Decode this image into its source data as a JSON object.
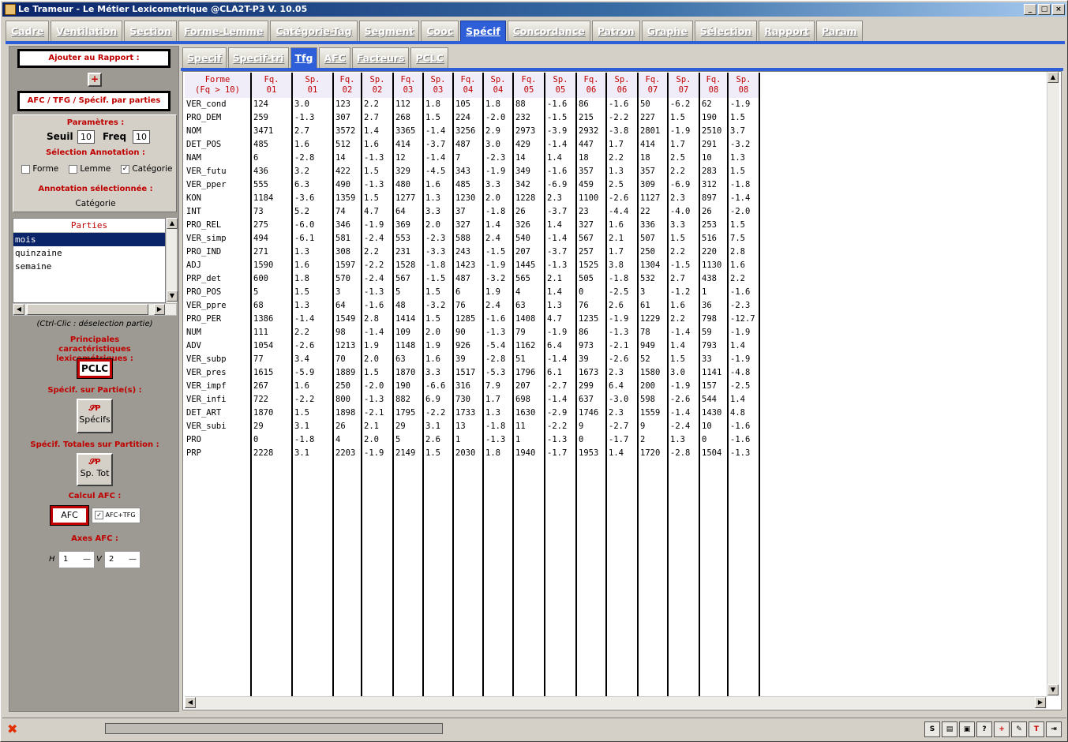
{
  "window": {
    "title": "Le Trameur - Le Métier Lexicometrique @CLA2T-P3 V. 10.05",
    "min": "_",
    "max": "□",
    "close": "×"
  },
  "main_tabs": [
    "Cadre",
    "Ventilation",
    "Section",
    "Forme-Lemme",
    "Catégorie-Tag",
    "Segment",
    "Cooc",
    "Spécif",
    "Concordance",
    "Patron",
    "Graphe",
    "Sélection",
    "Rapport",
    "Param"
  ],
  "active_main_tab": "Spécif",
  "sub_tabs": [
    "Specif",
    "Specif-tri",
    "Tfg",
    "AFC",
    "Facteurs",
    "PCLC"
  ],
  "active_sub_tab": "Tfg",
  "left": {
    "ajouter_rapport": "Ajouter au Rapport :",
    "plus_icon": "+",
    "afc_tfg": "AFC / TFG / Spécif. par parties",
    "parametres": "Paramètres :",
    "seuil_label": "Seuil",
    "seuil_value": "10",
    "freq_label": "Freq",
    "freq_value": "10",
    "selection_annotation": "Sélection Annotation :",
    "opt_forme": "Forme",
    "opt_lemme": "Lemme",
    "opt_categorie": "Catégorie",
    "annotation_selectionnee": "Annotation sélectionnée :",
    "annotation_value": "Catégorie",
    "parties_header": "Parties",
    "parties": [
      "mois",
      "quinzaine",
      "semaine"
    ],
    "ctrl_hint": "(Ctrl-Clic : déselection partie)",
    "principales": "Principales caractéristiques lexicométriques :",
    "pclc_btn": "PCLC",
    "specif_parties": "Spécif. sur Partie(s) :",
    "specifs_btn": "Spécifs",
    "specif_totales": "Spécif. Totales sur Partition :",
    "sptot_btn": "Sp. Tot",
    "calcul_afc": "Calcul AFC :",
    "afc_btn": "AFC",
    "afc_tfg_chk": "AFC+TFG",
    "axes_afc": "Axes AFC :",
    "h_label": "H",
    "h_value": "1",
    "v_label": "V",
    "v_value": "2"
  },
  "table": {
    "headers": [
      [
        "Forme",
        "(Fq > 10)"
      ],
      [
        "Fq.",
        "01"
      ],
      [
        "Sp.",
        "01"
      ],
      [
        "Fq.",
        "02"
      ],
      [
        "Sp.",
        "02"
      ],
      [
        "Fq.",
        "03"
      ],
      [
        "Sp.",
        "03"
      ],
      [
        "Fq.",
        "04"
      ],
      [
        "Sp.",
        "04"
      ],
      [
        "Fq.",
        "05"
      ],
      [
        "Sp.",
        "05"
      ],
      [
        "Fq.",
        "06"
      ],
      [
        "Sp.",
        "06"
      ],
      [
        "Fq.",
        "07"
      ],
      [
        "Sp.",
        "07"
      ],
      [
        "Fq.",
        "08"
      ],
      [
        "Sp.",
        "08"
      ]
    ],
    "rows": [
      [
        "VER_cond",
        "124",
        "3.0",
        "123",
        "2.2",
        "112",
        "1.8",
        "105",
        "1.8",
        "88",
        "-1.6",
        "86",
        "-1.6",
        "50",
        "-6.2",
        "62",
        "-1.9"
      ],
      [
        "PRO_DEM",
        "259",
        "-1.3",
        "307",
        "2.7",
        "268",
        "1.5",
        "224",
        "-2.0",
        "232",
        "-1.5",
        "215",
        "-2.2",
        "227",
        "1.5",
        "190",
        "1.5"
      ],
      [
        "NOM",
        "3471",
        "2.7",
        "3572",
        "1.4",
        "3365",
        "-1.4",
        "3256",
        "2.9",
        "2973",
        "-3.9",
        "2932",
        "-3.8",
        "2801",
        "-1.9",
        "2510",
        "3.7"
      ],
      [
        "DET_POS",
        "485",
        "1.6",
        "512",
        "1.6",
        "414",
        "-3.7",
        "487",
        "3.0",
        "429",
        "-1.4",
        "447",
        "1.7",
        "414",
        "1.7",
        "291",
        "-3.2"
      ],
      [
        "NAM",
        "6",
        "-2.8",
        "14",
        "-1.3",
        "12",
        "-1.4",
        "7",
        "-2.3",
        "14",
        "1.4",
        "18",
        "2.2",
        "18",
        "2.5",
        "10",
        "1.3"
      ],
      [
        "VER_futu",
        "436",
        "3.2",
        "422",
        "1.5",
        "329",
        "-4.5",
        "343",
        "-1.9",
        "349",
        "-1.6",
        "357",
        "1.3",
        "357",
        "2.2",
        "283",
        "1.5"
      ],
      [
        "VER_pper",
        "555",
        "6.3",
        "490",
        "-1.3",
        "480",
        "1.6",
        "485",
        "3.3",
        "342",
        "-6.9",
        "459",
        "2.5",
        "309",
        "-6.9",
        "312",
        "-1.8"
      ],
      [
        "KON",
        "1184",
        "-3.6",
        "1359",
        "1.5",
        "1277",
        "1.3",
        "1230",
        "2.0",
        "1228",
        "2.3",
        "1100",
        "-2.6",
        "1127",
        "2.3",
        "897",
        "-1.4"
      ],
      [
        "INT",
        "73",
        "5.2",
        "74",
        "4.7",
        "64",
        "3.3",
        "37",
        "-1.8",
        "26",
        "-3.7",
        "23",
        "-4.4",
        "22",
        "-4.0",
        "26",
        "-2.0"
      ],
      [
        "PRO_REL",
        "275",
        "-6.0",
        "346",
        "-1.9",
        "369",
        "2.0",
        "327",
        "1.4",
        "326",
        "1.4",
        "327",
        "1.6",
        "336",
        "3.3",
        "253",
        "1.5"
      ],
      [
        "VER_simp",
        "494",
        "-6.1",
        "581",
        "-2.4",
        "553",
        "-2.3",
        "588",
        "2.4",
        "540",
        "-1.4",
        "567",
        "2.1",
        "507",
        "1.5",
        "516",
        "7.5"
      ],
      [
        "PRO_IND",
        "271",
        "1.3",
        "308",
        "2.2",
        "231",
        "-3.3",
        "243",
        "-1.5",
        "207",
        "-3.7",
        "257",
        "1.7",
        "250",
        "2.2",
        "220",
        "2.8"
      ],
      [
        "ADJ",
        "1590",
        "1.6",
        "1597",
        "-2.2",
        "1528",
        "-1.8",
        "1423",
        "-1.9",
        "1445",
        "-1.3",
        "1525",
        "3.8",
        "1304",
        "-1.5",
        "1130",
        "1.6"
      ],
      [
        "PRP_det",
        "600",
        "1.8",
        "570",
        "-2.4",
        "567",
        "-1.5",
        "487",
        "-3.2",
        "565",
        "2.1",
        "505",
        "-1.8",
        "532",
        "2.7",
        "438",
        "2.2"
      ],
      [
        "PRO_POS",
        "5",
        "1.5",
        "3",
        "-1.3",
        "5",
        "1.5",
        "6",
        "1.9",
        "4",
        "1.4",
        "0",
        "-2.5",
        "3",
        "-1.2",
        "1",
        "-1.6"
      ],
      [
        "VER_ppre",
        "68",
        "1.3",
        "64",
        "-1.6",
        "48",
        "-3.2",
        "76",
        "2.4",
        "63",
        "1.3",
        "76",
        "2.6",
        "61",
        "1.6",
        "36",
        "-2.3"
      ],
      [
        "PRO_PER",
        "1386",
        "-1.4",
        "1549",
        "2.8",
        "1414",
        "1.5",
        "1285",
        "-1.6",
        "1408",
        "4.7",
        "1235",
        "-1.9",
        "1229",
        "2.2",
        "798",
        "-12.7"
      ],
      [
        "NUM",
        "111",
        "2.2",
        "98",
        "-1.4",
        "109",
        "2.0",
        "90",
        "-1.3",
        "79",
        "-1.9",
        "86",
        "-1.3",
        "78",
        "-1.4",
        "59",
        "-1.9"
      ],
      [
        "ADV",
        "1054",
        "-2.6",
        "1213",
        "1.9",
        "1148",
        "1.9",
        "926",
        "-5.4",
        "1162",
        "6.4",
        "973",
        "-2.1",
        "949",
        "1.4",
        "793",
        "1.4"
      ],
      [
        "VER_subp",
        "77",
        "3.4",
        "70",
        "2.0",
        "63",
        "1.6",
        "39",
        "-2.8",
        "51",
        "-1.4",
        "39",
        "-2.6",
        "52",
        "1.5",
        "33",
        "-1.9"
      ],
      [
        "VER_pres",
        "1615",
        "-5.9",
        "1889",
        "1.5",
        "1870",
        "3.3",
        "1517",
        "-5.3",
        "1796",
        "6.1",
        "1673",
        "2.3",
        "1580",
        "3.0",
        "1141",
        "-4.8"
      ],
      [
        "VER_impf",
        "267",
        "1.6",
        "250",
        "-2.0",
        "190",
        "-6.6",
        "316",
        "7.9",
        "207",
        "-2.7",
        "299",
        "6.4",
        "200",
        "-1.9",
        "157",
        "-2.5"
      ],
      [
        "VER_infi",
        "722",
        "-2.2",
        "800",
        "-1.3",
        "882",
        "6.9",
        "730",
        "1.7",
        "698",
        "-1.4",
        "637",
        "-3.0",
        "598",
        "-2.6",
        "544",
        "1.4"
      ],
      [
        "DET_ART",
        "1870",
        "1.5",
        "1898",
        "-2.1",
        "1795",
        "-2.2",
        "1733",
        "1.3",
        "1630",
        "-2.9",
        "1746",
        "2.3",
        "1559",
        "-1.4",
        "1430",
        "4.8"
      ],
      [
        "VER_subi",
        "29",
        "3.1",
        "26",
        "2.1",
        "29",
        "3.1",
        "13",
        "-1.8",
        "11",
        "-2.2",
        "9",
        "-2.7",
        "9",
        "-2.4",
        "10",
        "-1.6"
      ],
      [
        "PRO",
        "0",
        "-1.8",
        "4",
        "2.0",
        "5",
        "2.6",
        "1",
        "-1.3",
        "1",
        "-1.3",
        "0",
        "-1.7",
        "2",
        "1.3",
        "0",
        "-1.6"
      ],
      [
        "PRP",
        "2228",
        "3.1",
        "2203",
        "-1.9",
        "2149",
        "1.5",
        "2030",
        "1.8",
        "1940",
        "-1.7",
        "1953",
        "1.4",
        "1720",
        "-2.8",
        "1504",
        "-1.3"
      ]
    ]
  },
  "colors": {
    "accent_blue": "#2f5fd8",
    "header_red": "#c00000",
    "selection": "#0a246a"
  },
  "status": {
    "close_icon": "✖"
  }
}
